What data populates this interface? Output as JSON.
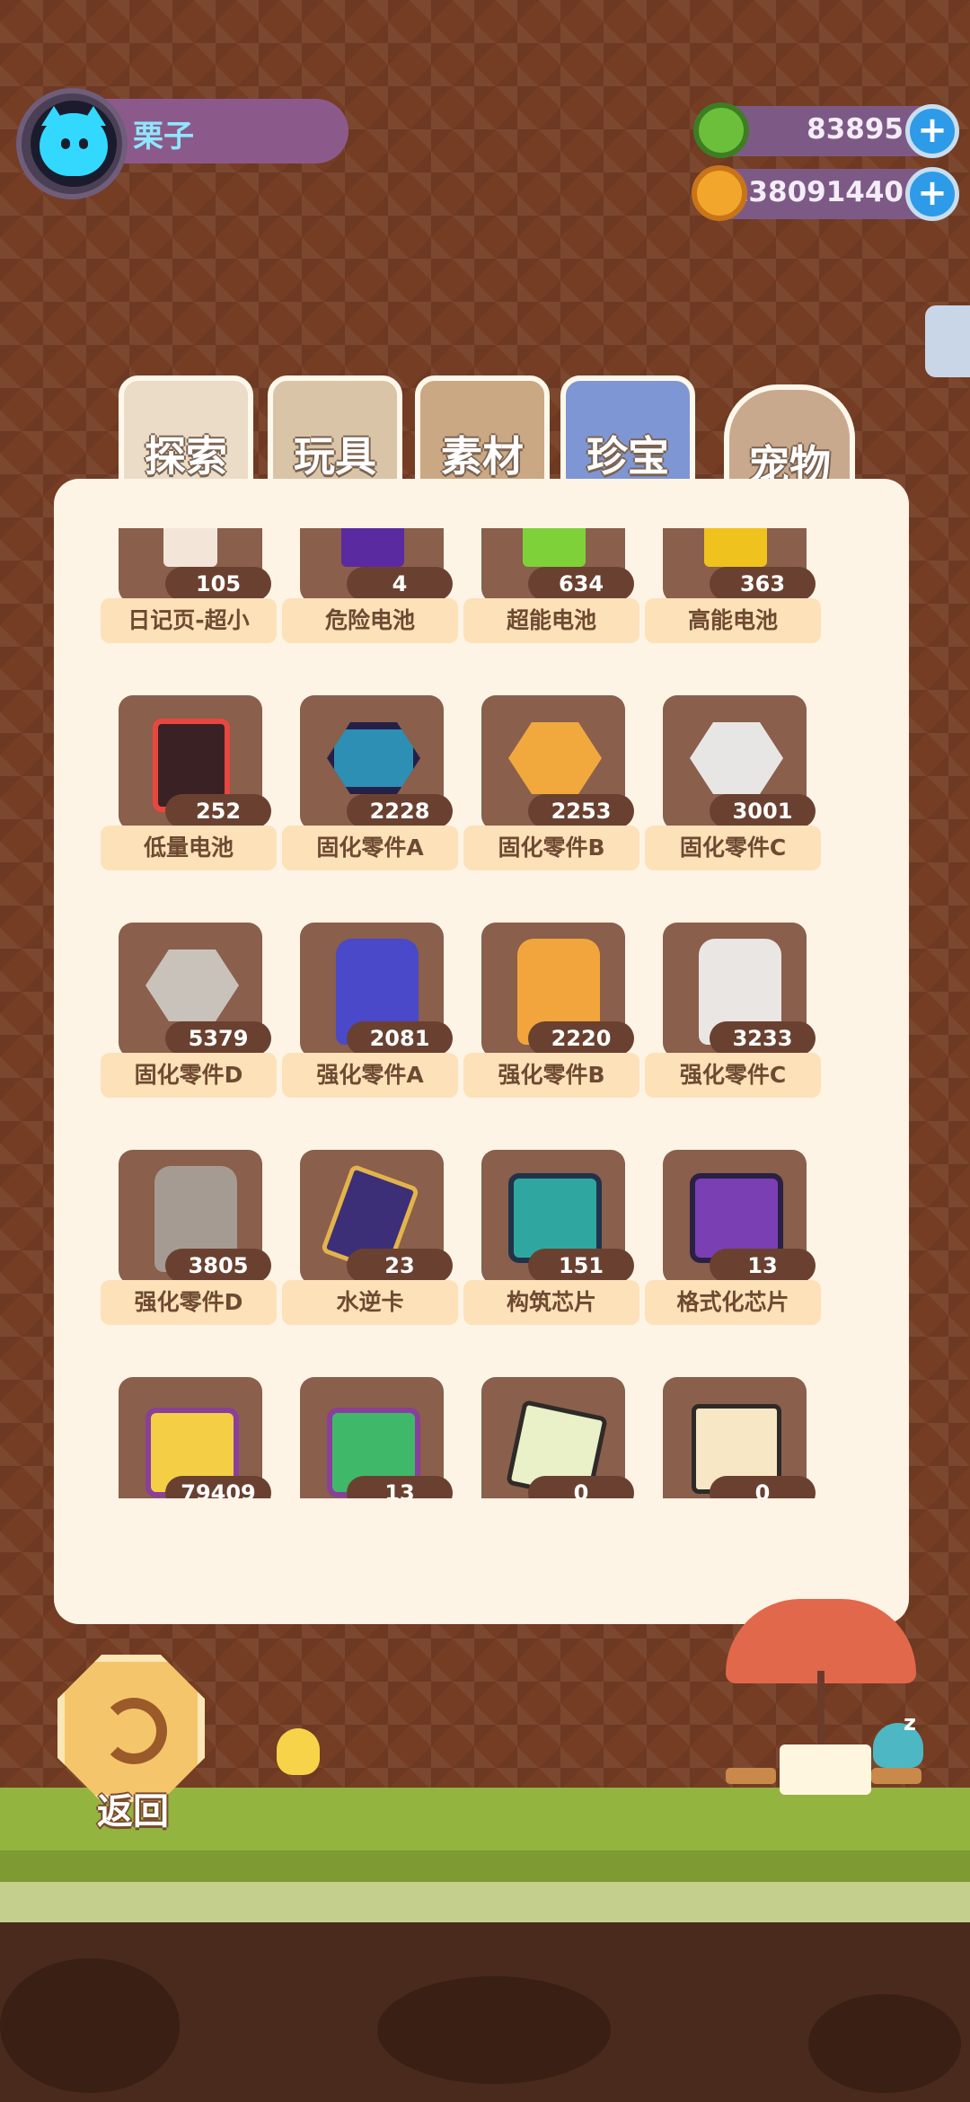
{
  "profile": {
    "name": "栗子"
  },
  "currency": {
    "coins": "83895",
    "planets": "138091440"
  },
  "tabs": [
    {
      "label": "探索"
    },
    {
      "label": "玩具"
    },
    {
      "label": "素材"
    },
    {
      "label": "珍宝"
    },
    {
      "label": "宠物"
    }
  ],
  "items": [
    {
      "name": "日记页-超小",
      "count": "105",
      "icon": "diary-page-icon"
    },
    {
      "name": "危险电池",
      "count": "4",
      "icon": "danger-battery-icon"
    },
    {
      "name": "超能电池",
      "count": "634",
      "icon": "super-battery-icon"
    },
    {
      "name": "高能电池",
      "count": "363",
      "icon": "high-battery-icon"
    },
    {
      "name": "低量电池",
      "count": "252",
      "icon": "low-battery-icon"
    },
    {
      "name": "固化零件A",
      "count": "2228",
      "icon": "nut-icon"
    },
    {
      "name": "固化零件B",
      "count": "2253",
      "icon": "nut-icon"
    },
    {
      "name": "固化零件C",
      "count": "3001",
      "icon": "nut-icon"
    },
    {
      "name": "固化零件D",
      "count": "5379",
      "icon": "nut-icon"
    },
    {
      "name": "强化零件A",
      "count": "2081",
      "icon": "bolt-icon"
    },
    {
      "name": "强化零件B",
      "count": "2220",
      "icon": "bolt-icon"
    },
    {
      "name": "强化零件C",
      "count": "3233",
      "icon": "bolt-icon"
    },
    {
      "name": "强化零件D",
      "count": "3805",
      "icon": "bolt-icon"
    },
    {
      "name": "水逆卡",
      "count": "23",
      "icon": "card-icon"
    },
    {
      "name": "构筑芯片",
      "count": "151",
      "icon": "chip-icon"
    },
    {
      "name": "格式化芯片",
      "count": "13",
      "icon": "chip-icon"
    },
    {
      "name": "",
      "count": "79409",
      "icon": "chip-icon"
    },
    {
      "name": "",
      "count": "13",
      "icon": "chip-icon"
    },
    {
      "name": "",
      "count": "0",
      "icon": "ticket-icon"
    },
    {
      "name": "",
      "count": "0",
      "icon": "ticket-icon"
    }
  ],
  "footer": {
    "back_label": "返回"
  },
  "colors": {
    "background": "#743d24",
    "panel": "#fdf4e6",
    "item_box": "#8a5f4b",
    "label_bg": "#fde1b8",
    "accent_plus": "#2d9be8"
  }
}
